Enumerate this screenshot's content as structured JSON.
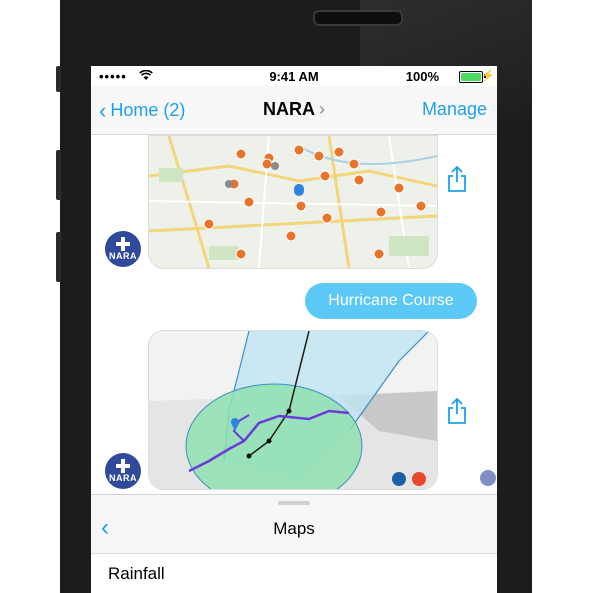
{
  "status": {
    "carrier": "••••• ",
    "time": "9:41 AM",
    "battery": "100%",
    "battery_level": 1.0
  },
  "nav": {
    "back_label": "Home (2)",
    "title": "NARA",
    "action": "Manage"
  },
  "chat": {
    "bubble_text": "Hurricane Course",
    "avatar_text": "NARA"
  },
  "drawer": {
    "title": "Maps",
    "row": "Rainfall"
  },
  "colors": {
    "accent": "#1ea0f0",
    "bubble": "#5bc8f5",
    "avatar": "#2f4a9a",
    "marker": "#e8732a",
    "cone": "#9fd8ee",
    "storm_zone": "#8fe0b0",
    "track": "#6a3bd8"
  },
  "icons": [
    "share-icon",
    "wifi-icon",
    "back-chevron-icon",
    "map-pin-icon"
  ]
}
